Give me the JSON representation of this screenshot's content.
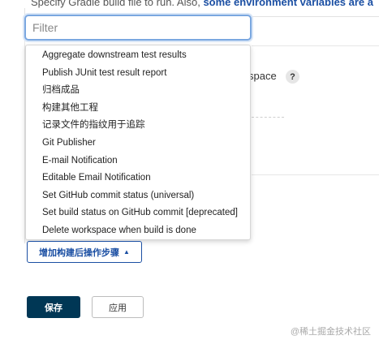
{
  "background": {
    "top_text": "Specify Gradle build file to run. Also, ",
    "top_link": "some environment variables are a",
    "partial_text": "space",
    "help_label": "?"
  },
  "filter": {
    "placeholder": "Filter"
  },
  "dropdown": {
    "items": [
      "Aggregate downstream test results",
      "Publish JUnit test result report",
      "归档成品",
      "构建其他工程",
      "记录文件的指纹用于追踪",
      "Git Publisher",
      "E-mail Notification",
      "Editable Email Notification",
      "Set GitHub commit status (universal)",
      "Set build status on GitHub commit [deprecated]",
      "Delete workspace when build is done"
    ]
  },
  "add_step_button": {
    "label": "增加构建后操作步骤",
    "icon": "caret-up-icon"
  },
  "actions": {
    "save": "保存",
    "apply": "应用"
  },
  "watermark": "@稀土掘金技术社区",
  "colors": {
    "primary": "#003755",
    "link": "#1b4fa3",
    "focus": "#7aa7e0"
  }
}
